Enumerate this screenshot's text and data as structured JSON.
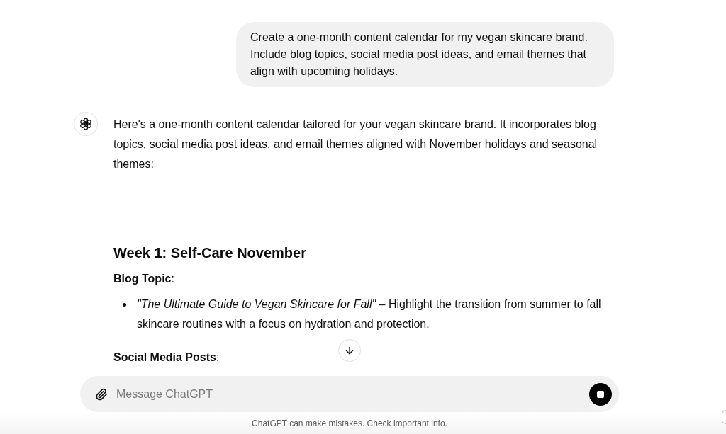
{
  "user_message": {
    "text": "Create a one-month content calendar for my vegan skincare brand. Include blog topics, social media post ideas, and email themes that align with upcoming holidays."
  },
  "assistant_message": {
    "intro": "Here's a one-month content calendar tailored for your vegan skincare brand. It incorporates blog topics, social media post ideas, and email themes aligned with November holidays and seasonal themes:",
    "sections": [
      {
        "heading": "Week 1: Self-Care November",
        "blocks": [
          {
            "label": "**Blog Topic**:",
            "items": [
              "*\"The Ultimate Guide to Vegan Skincare for Fall\"* – Highlight the transition from summer to fall skincare routines with a focus on hydration and protection."
            ]
          },
          {
            "label": "**Social Media Posts**:"
          }
        ]
      }
    ]
  },
  "composer": {
    "placeholder": "Message ChatGPT"
  },
  "footer": "ChatGPT can make mistakes. Check important info."
}
